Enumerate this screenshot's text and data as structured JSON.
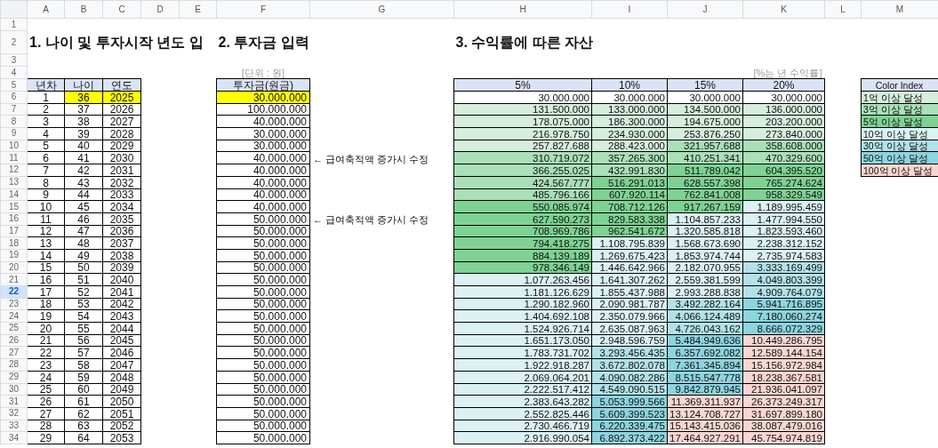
{
  "column_headers": [
    "A",
    "B",
    "C",
    "D",
    "E",
    "F",
    "G",
    "H",
    "I",
    "J",
    "K",
    "L",
    "M"
  ],
  "row_numbers": [
    {
      "label": "1",
      "selected": false
    },
    {
      "label": "2",
      "selected": false
    },
    {
      "label": "3",
      "selected": false
    },
    {
      "label": "4",
      "selected": false
    },
    {
      "label": "5",
      "selected": false
    },
    {
      "label": "6",
      "selected": false
    },
    {
      "label": "7",
      "selected": false
    },
    {
      "label": "8",
      "selected": false
    },
    {
      "label": "9",
      "selected": false
    },
    {
      "label": "10",
      "selected": false
    },
    {
      "label": "11",
      "selected": false
    },
    {
      "label": "12",
      "selected": false
    },
    {
      "label": "13",
      "selected": false
    },
    {
      "label": "14",
      "selected": false
    },
    {
      "label": "15",
      "selected": false
    },
    {
      "label": "16",
      "selected": false
    },
    {
      "label": "17",
      "selected": false
    },
    {
      "label": "18",
      "selected": false
    },
    {
      "label": "19",
      "selected": false
    },
    {
      "label": "20",
      "selected": false
    },
    {
      "label": "21",
      "selected": false
    },
    {
      "label": "22",
      "selected": true
    },
    {
      "label": "23",
      "selected": false
    },
    {
      "label": "24",
      "selected": false
    },
    {
      "label": "25",
      "selected": false
    },
    {
      "label": "26",
      "selected": false
    },
    {
      "label": "27",
      "selected": false
    },
    {
      "label": "28",
      "selected": false
    },
    {
      "label": "29",
      "selected": false
    },
    {
      "label": "30",
      "selected": false
    },
    {
      "label": "31",
      "selected": false
    },
    {
      "label": "32",
      "selected": false
    },
    {
      "label": "33",
      "selected": false
    },
    {
      "label": "34",
      "selected": false
    }
  ],
  "titles": {
    "section_1": "1. 나이 및 투자시작 년도 입",
    "section_2": "2. 투자금 입력",
    "section_3": "3. 수익률에 따른 자산"
  },
  "unit_note": "[단위 : 원]",
  "rate_note": "[%는 년 수익률]",
  "age_table": {
    "columns": [
      "년차",
      "나이",
      "연도"
    ]
  },
  "investment_table": {
    "column": "투자금(원금)"
  },
  "asset_table": {
    "columns": [
      "5%",
      "10%",
      "15%",
      "20%"
    ]
  },
  "rows": [
    {
      "year_no": "1",
      "age": "36",
      "year": "2025",
      "highlighted": true,
      "investment": "30.000.000",
      "assets": [
        {
          "value": "30.000.000",
          "color": "#ffffff"
        },
        {
          "value": "30.000.000",
          "color": "#ffffff"
        },
        {
          "value": "30.000.000",
          "color": "#ffffff"
        },
        {
          "value": "30.000.000",
          "color": "#ffffff"
        }
      ]
    },
    {
      "year_no": "2",
      "age": "37",
      "year": "2026",
      "highlighted": false,
      "investment": "100.000.000",
      "assets": [
        {
          "value": "131.500.000",
          "color": "#d5efdc"
        },
        {
          "value": "133.000.000",
          "color": "#d5efdc"
        },
        {
          "value": "134.500.000",
          "color": "#d5efdc"
        },
        {
          "value": "136.000.000",
          "color": "#d5efdc"
        }
      ]
    },
    {
      "year_no": "3",
      "age": "38",
      "year": "2027",
      "highlighted": false,
      "investment": "40.000.000",
      "assets": [
        {
          "value": "178.075.000",
          "color": "#d5efdc"
        },
        {
          "value": "186.300.000",
          "color": "#d5efdc"
        },
        {
          "value": "194.675.000",
          "color": "#d5efdc"
        },
        {
          "value": "203.200.000",
          "color": "#d5efdc"
        }
      ]
    },
    {
      "year_no": "4",
      "age": "39",
      "year": "2028",
      "highlighted": false,
      "investment": "30.000.000",
      "assets": [
        {
          "value": "216.978.750",
          "color": "#d5efdc"
        },
        {
          "value": "234.930.000",
          "color": "#d5efdc"
        },
        {
          "value": "253.876.250",
          "color": "#d5efdc"
        },
        {
          "value": "273.840.000",
          "color": "#d5efdc"
        }
      ]
    },
    {
      "year_no": "5",
      "age": "40",
      "year": "2029",
      "highlighted": false,
      "investment": "30.000.000",
      "assets": [
        {
          "value": "257.827.688",
          "color": "#d5efdc"
        },
        {
          "value": "288.423.000",
          "color": "#d5efdc"
        },
        {
          "value": "321.957.688",
          "color": "#a9e0b8"
        },
        {
          "value": "358.608.000",
          "color": "#a9e0b8"
        }
      ]
    },
    {
      "year_no": "6",
      "age": "41",
      "year": "2030",
      "highlighted": false,
      "investment": "40.000.000",
      "note": "← 급여축적액 증가시 수정",
      "assets": [
        {
          "value": "310.719.072",
          "color": "#a9e0b8"
        },
        {
          "value": "357.265.300",
          "color": "#a9e0b8"
        },
        {
          "value": "410.251.341",
          "color": "#a9e0b8"
        },
        {
          "value": "470.329.600",
          "color": "#a9e0b8"
        }
      ]
    },
    {
      "year_no": "7",
      "age": "42",
      "year": "2031",
      "highlighted": false,
      "investment": "40.000.000",
      "assets": [
        {
          "value": "366.255.025",
          "color": "#a9e0b8"
        },
        {
          "value": "432.991.830",
          "color": "#a9e0b8"
        },
        {
          "value": "511.789.042",
          "color": "#7ed293"
        },
        {
          "value": "604.395.520",
          "color": "#7ed293"
        }
      ]
    },
    {
      "year_no": "8",
      "age": "43",
      "year": "2032",
      "highlighted": false,
      "investment": "40.000.000",
      "assets": [
        {
          "value": "424.567.777",
          "color": "#a9e0b8"
        },
        {
          "value": "516.291.013",
          "color": "#7ed293"
        },
        {
          "value": "628.557.398",
          "color": "#7ed293"
        },
        {
          "value": "765.274.624",
          "color": "#7ed293"
        }
      ]
    },
    {
      "year_no": "9",
      "age": "44",
      "year": "2033",
      "highlighted": false,
      "investment": "40.000.000",
      "assets": [
        {
          "value": "485.796.166",
          "color": "#a9e0b8"
        },
        {
          "value": "607.920.114",
          "color": "#7ed293"
        },
        {
          "value": "762.841.008",
          "color": "#7ed293"
        },
        {
          "value": "958.329.549",
          "color": "#7ed293"
        }
      ]
    },
    {
      "year_no": "10",
      "age": "45",
      "year": "2034",
      "highlighted": false,
      "investment": "40.000.000",
      "assets": [
        {
          "value": "550.085.974",
          "color": "#7ed293"
        },
        {
          "value": "708.712.126",
          "color": "#7ed293"
        },
        {
          "value": "917.267.159",
          "color": "#7ed293"
        },
        {
          "value": "1.189.995.459",
          "color": "#dbf1f4"
        }
      ]
    },
    {
      "year_no": "11",
      "age": "46",
      "year": "2035",
      "highlighted": false,
      "investment": "50.000.000",
      "note": "← 급여축적액 증가시 수정",
      "assets": [
        {
          "value": "627.590.273",
          "color": "#7ed293"
        },
        {
          "value": "829.583.338",
          "color": "#7ed293"
        },
        {
          "value": "1.104.857.233",
          "color": "#dbf1f4"
        },
        {
          "value": "1.477.994.550",
          "color": "#dbf1f4"
        }
      ]
    },
    {
      "year_no": "12",
      "age": "47",
      "year": "2036",
      "highlighted": false,
      "investment": "50.000.000",
      "assets": [
        {
          "value": "708.969.786",
          "color": "#7ed293"
        },
        {
          "value": "962.541.672",
          "color": "#7ed293"
        },
        {
          "value": "1.320.585.818",
          "color": "#dbf1f4"
        },
        {
          "value": "1.823.593.460",
          "color": "#dbf1f4"
        }
      ]
    },
    {
      "year_no": "13",
      "age": "48",
      "year": "2037",
      "highlighted": false,
      "investment": "50.000.000",
      "assets": [
        {
          "value": "794.418.275",
          "color": "#7ed293"
        },
        {
          "value": "1.108.795.839",
          "color": "#dbf1f4"
        },
        {
          "value": "1.568.673.690",
          "color": "#dbf1f4"
        },
        {
          "value": "2.238.312.152",
          "color": "#dbf1f4"
        }
      ]
    },
    {
      "year_no": "14",
      "age": "49",
      "year": "2038",
      "highlighted": false,
      "investment": "50.000.000",
      "assets": [
        {
          "value": "884.139.189",
          "color": "#7ed293"
        },
        {
          "value": "1.269.675.423",
          "color": "#dbf1f4"
        },
        {
          "value": "1.853.974.744",
          "color": "#dbf1f4"
        },
        {
          "value": "2.735.974.583",
          "color": "#dbf1f4"
        }
      ]
    },
    {
      "year_no": "15",
      "age": "50",
      "year": "2039",
      "highlighted": false,
      "investment": "50.000.000",
      "assets": [
        {
          "value": "978.346.149",
          "color": "#7ed293"
        },
        {
          "value": "1.446.642.966",
          "color": "#dbf1f4"
        },
        {
          "value": "2.182.070.955",
          "color": "#dbf1f4"
        },
        {
          "value": "3.333.169.499",
          "color": "#b2e2e9"
        }
      ]
    },
    {
      "year_no": "16",
      "age": "51",
      "year": "2040",
      "highlighted": false,
      "investment": "50.000.000",
      "assets": [
        {
          "value": "1.077.263.456",
          "color": "#dbf1f4"
        },
        {
          "value": "1.641.307.262",
          "color": "#dbf1f4"
        },
        {
          "value": "2.559.381.599",
          "color": "#dbf1f4"
        },
        {
          "value": "4.049.803.399",
          "color": "#b2e2e9"
        }
      ]
    },
    {
      "year_no": "17",
      "age": "52",
      "year": "2041",
      "highlighted": false,
      "investment": "50.000.000",
      "assets": [
        {
          "value": "1.181.126.629",
          "color": "#dbf1f4"
        },
        {
          "value": "1.855.437.988",
          "color": "#dbf1f4"
        },
        {
          "value": "2.993.288.838",
          "color": "#dbf1f4"
        },
        {
          "value": "4.909.764.079",
          "color": "#b2e2e9"
        }
      ]
    },
    {
      "year_no": "18",
      "age": "53",
      "year": "2042",
      "highlighted": false,
      "investment": "50.000.000",
      "assets": [
        {
          "value": "1.290.182.960",
          "color": "#dbf1f4"
        },
        {
          "value": "2.090.981.787",
          "color": "#dbf1f4"
        },
        {
          "value": "3.492.282.164",
          "color": "#b2e2e9"
        },
        {
          "value": "5.941.716.895",
          "color": "#8dd4de"
        }
      ]
    },
    {
      "year_no": "19",
      "age": "54",
      "year": "2043",
      "highlighted": false,
      "investment": "50.000.000",
      "assets": [
        {
          "value": "1.404.692.108",
          "color": "#dbf1f4"
        },
        {
          "value": "2.350.079.966",
          "color": "#dbf1f4"
        },
        {
          "value": "4.066.124.489",
          "color": "#b2e2e9"
        },
        {
          "value": "7.180.060.274",
          "color": "#8dd4de"
        }
      ]
    },
    {
      "year_no": "20",
      "age": "55",
      "year": "2044",
      "highlighted": false,
      "investment": "50.000.000",
      "assets": [
        {
          "value": "1.524.926.714",
          "color": "#dbf1f4"
        },
        {
          "value": "2.635.087.963",
          "color": "#dbf1f4"
        },
        {
          "value": "4.726.043.162",
          "color": "#b2e2e9"
        },
        {
          "value": "8.666.072.329",
          "color": "#8dd4de"
        }
      ]
    },
    {
      "year_no": "21",
      "age": "56",
      "year": "2045",
      "highlighted": false,
      "investment": "50.000.000",
      "assets": [
        {
          "value": "1.651.173.050",
          "color": "#dbf1f4"
        },
        {
          "value": "2.948.596.759",
          "color": "#dbf1f4"
        },
        {
          "value": "5.484.949.636",
          "color": "#8dd4de"
        },
        {
          "value": "10.449.286.795",
          "color": "#fad6d1"
        }
      ]
    },
    {
      "year_no": "22",
      "age": "57",
      "year": "2046",
      "highlighted": false,
      "investment": "50.000.000",
      "assets": [
        {
          "value": "1.783.731.702",
          "color": "#dbf1f4"
        },
        {
          "value": "3.293.456.435",
          "color": "#b2e2e9"
        },
        {
          "value": "6.357.692.082",
          "color": "#8dd4de"
        },
        {
          "value": "12.589.144.154",
          "color": "#fad6d1"
        }
      ]
    },
    {
      "year_no": "23",
      "age": "58",
      "year": "2047",
      "highlighted": false,
      "investment": "50.000.000",
      "assets": [
        {
          "value": "1.922.918.287",
          "color": "#dbf1f4"
        },
        {
          "value": "3.672.802.078",
          "color": "#b2e2e9"
        },
        {
          "value": "7.361.345.894",
          "color": "#8dd4de"
        },
        {
          "value": "15.156.972.984",
          "color": "#fad6d1"
        }
      ]
    },
    {
      "year_no": "24",
      "age": "59",
      "year": "2048",
      "highlighted": false,
      "investment": "50.000.000",
      "assets": [
        {
          "value": "2.069.064.201",
          "color": "#dbf1f4"
        },
        {
          "value": "4.090.082.286",
          "color": "#b2e2e9"
        },
        {
          "value": "8.515.547.778",
          "color": "#8dd4de"
        },
        {
          "value": "18.238.367.581",
          "color": "#fad6d1"
        }
      ]
    },
    {
      "year_no": "25",
      "age": "60",
      "year": "2049",
      "highlighted": false,
      "investment": "50.000.000",
      "assets": [
        {
          "value": "2.222.517.412",
          "color": "#dbf1f4"
        },
        {
          "value": "4.549.090.515",
          "color": "#b2e2e9"
        },
        {
          "value": "9.842.879.945",
          "color": "#8dd4de"
        },
        {
          "value": "21.936.041.097",
          "color": "#fad6d1"
        }
      ]
    },
    {
      "year_no": "26",
      "age": "61",
      "year": "2050",
      "highlighted": false,
      "investment": "50.000.000",
      "assets": [
        {
          "value": "2.383.643.282",
          "color": "#dbf1f4"
        },
        {
          "value": "5.053.999.566",
          "color": "#8dd4de"
        },
        {
          "value": "11.369.311.937",
          "color": "#fad6d1"
        },
        {
          "value": "26.373.249.317",
          "color": "#fad6d1"
        }
      ]
    },
    {
      "year_no": "27",
      "age": "62",
      "year": "2051",
      "highlighted": false,
      "investment": "50.000.000",
      "assets": [
        {
          "value": "2.552.825.446",
          "color": "#dbf1f4"
        },
        {
          "value": "5.609.399.523",
          "color": "#8dd4de"
        },
        {
          "value": "13.124.708.727",
          "color": "#fad6d1"
        },
        {
          "value": "31.697.899.180",
          "color": "#fad6d1"
        }
      ]
    },
    {
      "year_no": "28",
      "age": "63",
      "year": "2052",
      "highlighted": false,
      "investment": "50.000.000",
      "assets": [
        {
          "value": "2.730.466.719",
          "color": "#dbf1f4"
        },
        {
          "value": "6.220.339.475",
          "color": "#8dd4de"
        },
        {
          "value": "15.143.415.036",
          "color": "#fad6d1"
        },
        {
          "value": "38.087.479.016",
          "color": "#fad6d1"
        }
      ]
    },
    {
      "year_no": "29",
      "age": "64",
      "year": "2053",
      "highlighted": false,
      "investment": "50.000.000",
      "assets": [
        {
          "value": "2.916.990.054",
          "color": "#dbf1f4"
        },
        {
          "value": "6.892.373.422",
          "color": "#8dd4de"
        },
        {
          "value": "17.464.927.291",
          "color": "#fad6d1"
        },
        {
          "value": "45.754.974.819",
          "color": "#fad6d1"
        }
      ]
    }
  ],
  "color_index": {
    "title": "Color Index",
    "items": [
      {
        "label": "1억 이상 달성",
        "color": "#d5efdc"
      },
      {
        "label": "3억 이상 달성",
        "color": "#a9e0b8"
      },
      {
        "label": "5억 이상 달성",
        "color": "#7ed293"
      },
      {
        "label": "10억 이상 달성",
        "color": "#dbf1f4"
      },
      {
        "label": "30억 이상 달성",
        "color": "#b2e2e9"
      },
      {
        "label": "50억 이상 달성",
        "color": "#8dd4de"
      },
      {
        "label": "100억 이상 달성",
        "color": "#fad6d1"
      }
    ]
  }
}
